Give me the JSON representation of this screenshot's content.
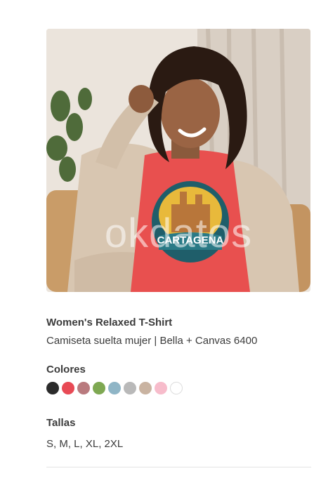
{
  "product": {
    "image_alt": "Woman smiling wearing a coral relaxed t-shirt with Cartagena print",
    "print_text": "CARTAGENA",
    "watermark": "okdatos",
    "title": "Women's Relaxed T-Shirt",
    "subtitle": "Camiseta suelta mujer | Bella + Canvas 6400"
  },
  "colors": {
    "label": "Colores",
    "swatches": [
      {
        "name": "black",
        "hex": "#2b2b2b"
      },
      {
        "name": "red",
        "hex": "#e84a55"
      },
      {
        "name": "mauve",
        "hex": "#b97a7e"
      },
      {
        "name": "green",
        "hex": "#7ea852"
      },
      {
        "name": "light-blue",
        "hex": "#8fb5c6"
      },
      {
        "name": "grey",
        "hex": "#b9b9b9"
      },
      {
        "name": "tan",
        "hex": "#c9b3a1"
      },
      {
        "name": "pink",
        "hex": "#f7bccb"
      },
      {
        "name": "white",
        "hex": "#ffffff"
      }
    ]
  },
  "sizes": {
    "label": "Tallas",
    "value": "S, M, L, XL, 2XL"
  }
}
